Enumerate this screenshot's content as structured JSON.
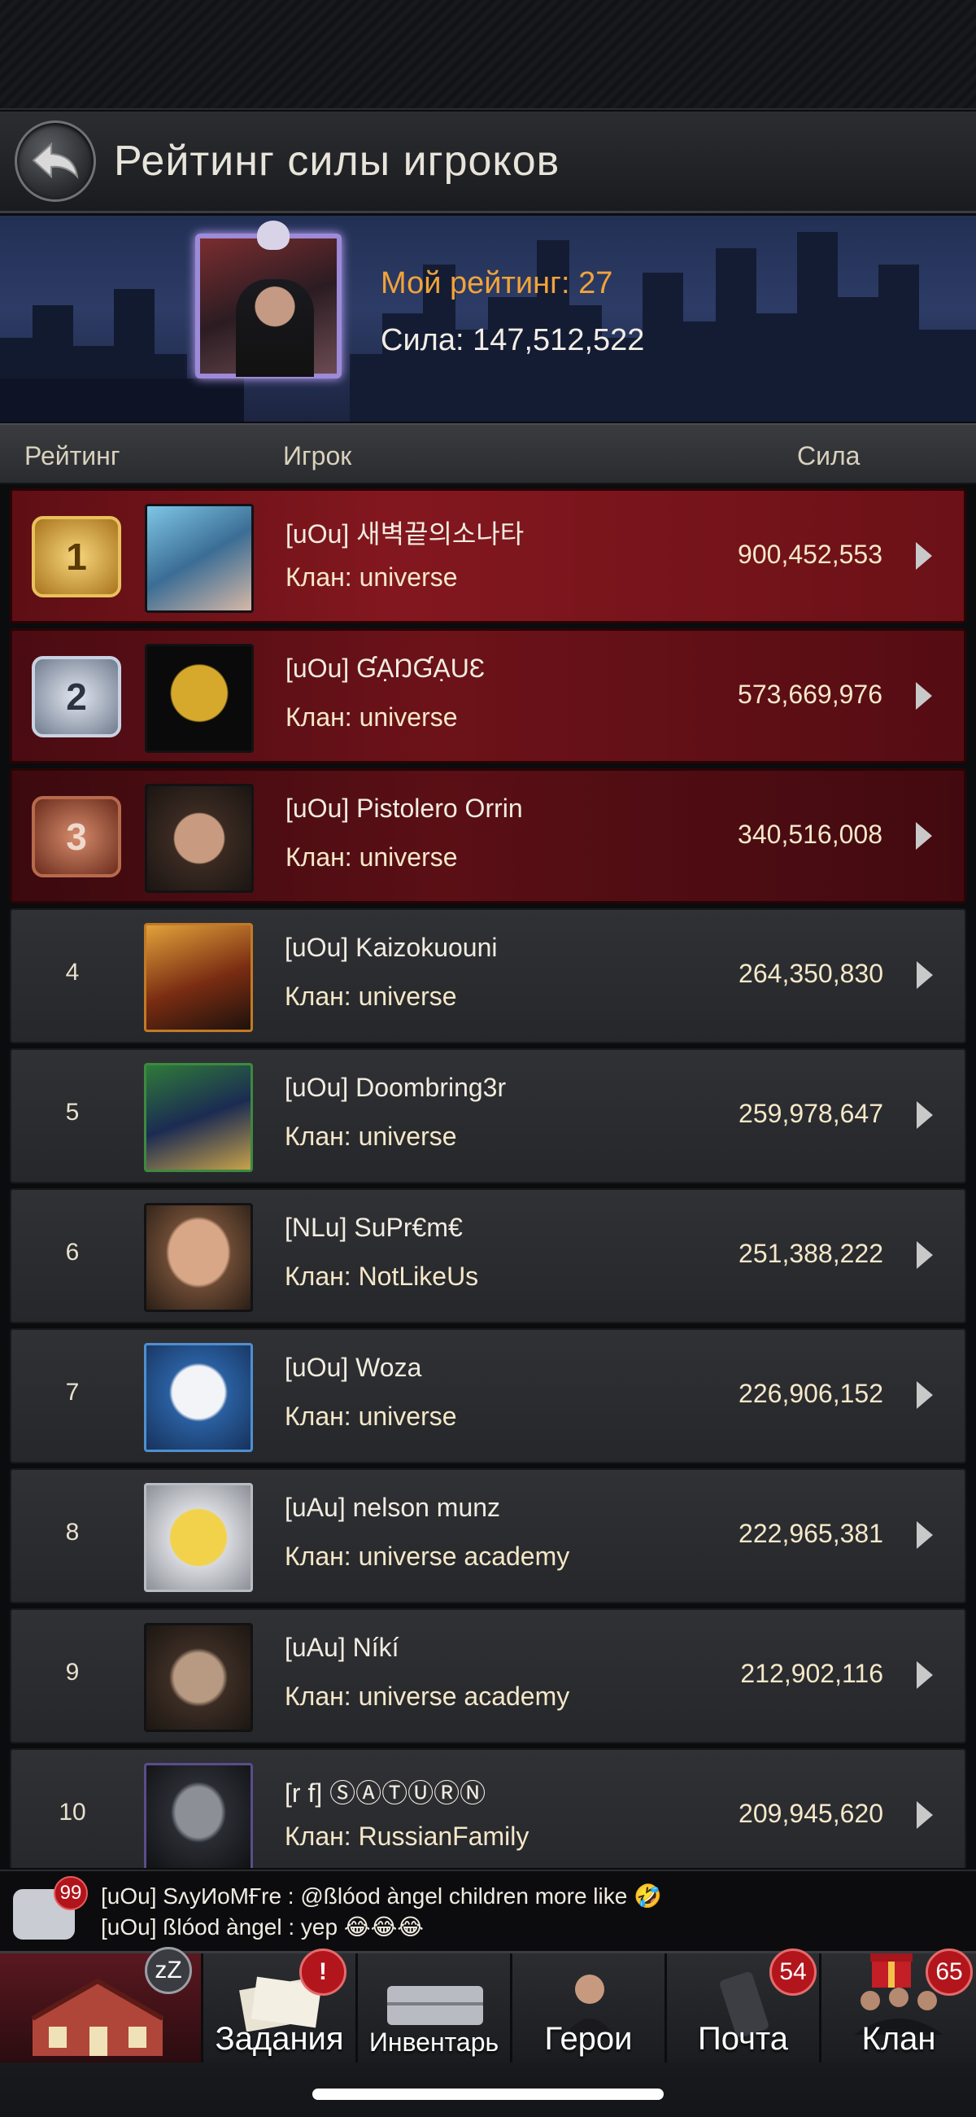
{
  "page": {
    "title": "Рейтинг силы игроков",
    "my_rating": "Мой рейтинг: 27",
    "my_power": "Сила: 147,512,522"
  },
  "table": {
    "headers": {
      "rank": "Рейтинг",
      "player": "Игрок",
      "power": "Сила"
    },
    "rows": [
      {
        "rank": "1",
        "name": "[uOu] 새벽끝의소나타",
        "clan": "Клан: universe",
        "power": "900,452,553"
      },
      {
        "rank": "2",
        "name": "[uOu] ƓẠŊƓẠUƐ",
        "clan": "Клан: universe",
        "power": "573,669,976"
      },
      {
        "rank": "3",
        "name": "[uOu] Pistolero Orrin",
        "clan": "Клан: universe",
        "power": "340,516,008"
      },
      {
        "rank": "4",
        "name": "[uOu] Kaizokuouni",
        "clan": "Клан: universe",
        "power": "264,350,830"
      },
      {
        "rank": "5",
        "name": "[uOu] Doombring3r",
        "clan": "Клан: universe",
        "power": "259,978,647"
      },
      {
        "rank": "6",
        "name": "[NLu] SuPr€m€",
        "clan": "Клан: NotLikeUs",
        "power": "251,388,222"
      },
      {
        "rank": "7",
        "name": "[uOu] Woza",
        "clan": "Клан: universe",
        "power": "226,906,152"
      },
      {
        "rank": "8",
        "name": "[uAu] nelson munz",
        "clan": "Клан: universe academy",
        "power": "222,965,381"
      },
      {
        "rank": "9",
        "name": "[uAu] Níkí",
        "clan": "Клан: universe academy",
        "power": "212,902,116"
      },
      {
        "rank": "10",
        "name": "[r f] ⓈⒶⓉⓊⓇⓃ",
        "clan": "Клан: RussianFamily",
        "power": "209,945,620"
      }
    ]
  },
  "chat": {
    "unread": "99",
    "lines": [
      "[uOu] SʌуИоМҒre : @ßlóod àngel children more like 🤣",
      "[uOu] ßlóod àngel : yep 😂😂😂"
    ]
  },
  "nav": {
    "items": [
      {
        "label": "",
        "badge": "zZ"
      },
      {
        "label": "Задания",
        "badge": "!"
      },
      {
        "label": "Инвентарь",
        "badge": ""
      },
      {
        "label": "Герои",
        "badge": ""
      },
      {
        "label": "Почта",
        "badge": "54"
      },
      {
        "label": "Клан",
        "badge": "65"
      }
    ]
  },
  "colors": {
    "accent_orange": "#f2a33a",
    "top_row_red": "#83171f",
    "badge_red": "#b3151c"
  }
}
